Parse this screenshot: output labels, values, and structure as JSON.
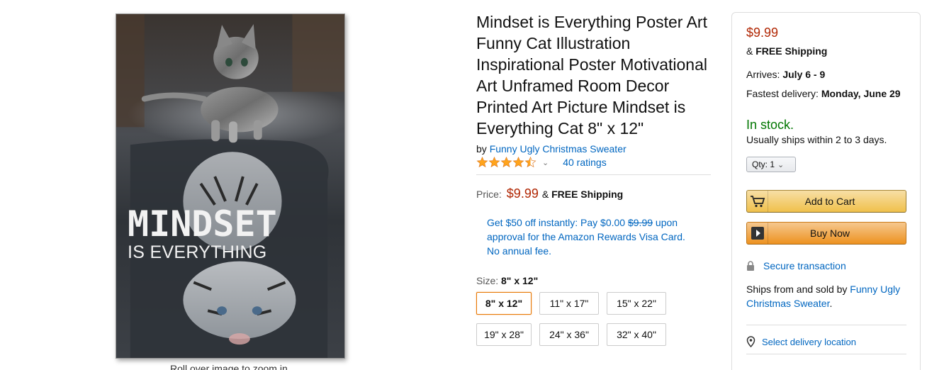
{
  "product": {
    "image": {
      "poster_title": "MINDSET",
      "poster_subtitle": "IS EVERYTHING",
      "caption": "Roll over image to zoom in"
    },
    "title": "Mindset is Everything Poster Art Funny Cat Illustration Inspirational Poster Motivational Art Unframed Room Decor Printed Art Picture Mindset is Everything Cat 8\" x 12\"",
    "by_label": "by",
    "brand": "Funny Ugly Christmas Sweater",
    "rating": 4.5,
    "ratings_text": "40 ratings",
    "price_label": "Price:",
    "price": "$9.99",
    "amp": "&",
    "free_shipping": "FREE Shipping",
    "promo": {
      "part1": "Get $50 off instantly: Pay $0.00",
      "strike": "$9.99",
      "part2": "upon approval for the Amazon Rewards Visa Card. No annual fee."
    },
    "size_label": "Size:",
    "size_selected": "8\" x 12\"",
    "sizes": [
      "8\" x 12\"",
      "11\" x 17\"",
      "15\" x 22\"",
      "19\" x 28\"",
      "24\" x 36\"",
      "32\" x 40\""
    ]
  },
  "buybox": {
    "price": "$9.99",
    "amp": "&",
    "free_shipping": "FREE Shipping",
    "arrives_label": "Arrives:",
    "arrives": "July 6 - 9",
    "fastest_label": "Fastest delivery:",
    "fastest": "Monday, June 29",
    "stock": "In stock.",
    "ships_in": "Usually ships within 2 to 3 days.",
    "qty_label": "Qty:",
    "qty_value": "1",
    "add_to_cart": "Add to Cart",
    "buy_now": "Buy Now",
    "secure": "Secure transaction",
    "sold_by_prefix": "Ships from and sold by",
    "sold_by": "Funny Ugly Christmas Sweater",
    "sold_by_suffix": ".",
    "deliver": "Select delivery location"
  },
  "colors": {
    "link": "#0066c0",
    "price": "#b12704",
    "in_stock": "#007600",
    "star": "#ffa41c",
    "selected_border": "#e77600"
  },
  "icons": [
    "star-icon",
    "chevron-down-icon",
    "cart-icon",
    "play-icon",
    "lock-icon",
    "location-pin-icon"
  ]
}
